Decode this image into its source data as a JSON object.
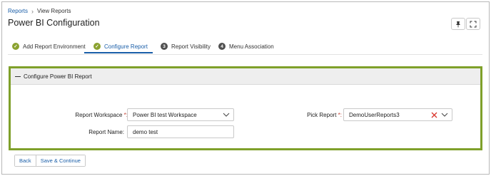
{
  "breadcrumb": {
    "root": "Reports",
    "current": "View Reports"
  },
  "page": {
    "title": "Power BI Configuration"
  },
  "header_buttons": {
    "pin_icon": "pin-icon",
    "fullscreen_icon": "fullscreen-icon"
  },
  "tabs": [
    {
      "label": "Add Report Environment",
      "status": "done",
      "badge": ""
    },
    {
      "label": "Configure Report",
      "status": "done",
      "badge": ""
    },
    {
      "label": "Report Visibility",
      "status": "todo",
      "badge": "3"
    },
    {
      "label": "Menu Association",
      "status": "todo",
      "badge": "4"
    }
  ],
  "section": {
    "title": "Configure Power BI Report"
  },
  "form": {
    "workspace": {
      "label": "Report Workspace",
      "required_mark": "*:",
      "value": "Power BI test Workspace"
    },
    "report_name": {
      "label": "Report Name:",
      "value": "demo test"
    },
    "pick_report": {
      "label": "Pick Report",
      "required_mark": "*:",
      "value": "DemoUserReports3"
    }
  },
  "footer": {
    "back": "Back",
    "save_continue": "Save & Continue"
  },
  "colors": {
    "accent": "#1a5ea8",
    "success": "#8ba230",
    "section_border": "#7fa02a",
    "clear": "#d9342b"
  }
}
